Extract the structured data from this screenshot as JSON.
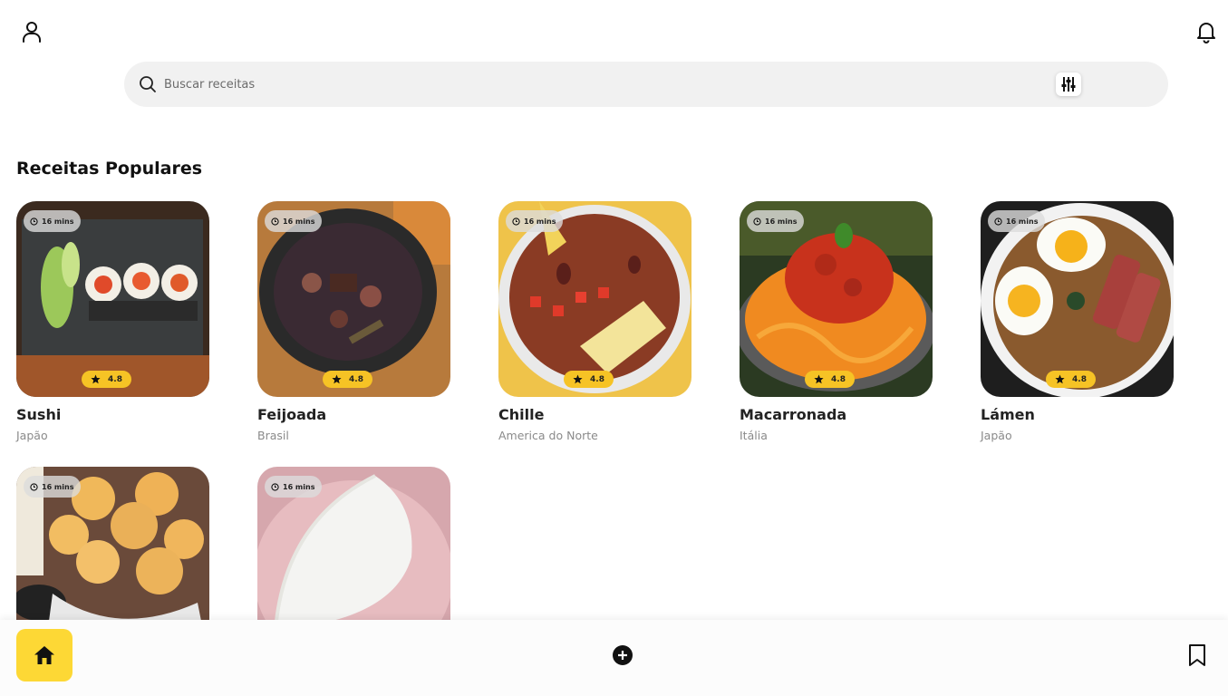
{
  "header": {
    "user_icon": "user-icon",
    "bell_icon": "bell-icon"
  },
  "search": {
    "placeholder": "Buscar receitas",
    "value": "",
    "icon": "search-icon",
    "filter_icon": "sliders-icon"
  },
  "section": {
    "title": "Receitas Populares"
  },
  "recipes": [
    {
      "name": "Sushi",
      "origin": "Japão",
      "time": "16 mins",
      "rating": "4.8"
    },
    {
      "name": "Feijoada",
      "origin": "Brasil",
      "time": "16 mins",
      "rating": "4.8"
    },
    {
      "name": "Chille",
      "origin": "America do Norte",
      "time": "16 mins",
      "rating": "4.8"
    },
    {
      "name": "Macarronada",
      "origin": "Itália",
      "time": "16 mins",
      "rating": "4.8"
    },
    {
      "name": "Lámen",
      "origin": "Japão",
      "time": "16 mins",
      "rating": "4.8"
    },
    {
      "name": "",
      "origin": "",
      "time": "16 mins",
      "rating": ""
    },
    {
      "name": "",
      "origin": "",
      "time": "16 mins",
      "rating": ""
    }
  ],
  "bottom_nav": {
    "home_icon": "home-icon",
    "add_icon": "plus-circle-icon",
    "bookmark_icon": "bookmark-icon"
  },
  "colors": {
    "accent": "#fdd835",
    "rating_badge": "#f6c325",
    "search_bg": "#f1f1f1"
  }
}
